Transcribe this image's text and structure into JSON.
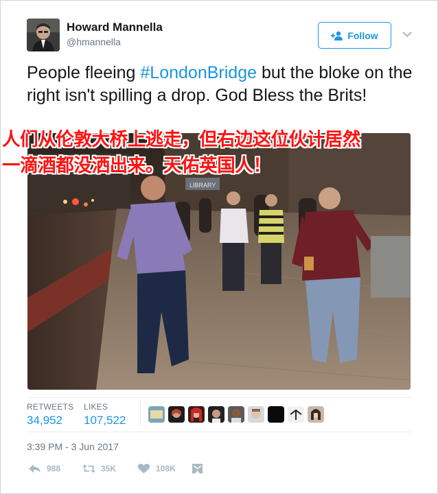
{
  "user": {
    "name": "Howard Mannella",
    "handle": "@hmannella"
  },
  "follow_label": "Follow",
  "tweet": {
    "text_before": "People fleeing ",
    "hashtag": "#LondonBridge",
    "text_after": " but the bloke on the right isn't spilling a drop. God Bless the Brits!"
  },
  "chinese_caption": {
    "line1": "人们从伦敦大桥上逃走，但右边这位伙计居然",
    "line2": "一滴酒都没洒出来。天佑英国人！"
  },
  "photo_sign": "LIBRARY",
  "stats": {
    "retweets_label": "RETWEETS",
    "retweets_value": "34,952",
    "likes_label": "LIKES",
    "likes_value": "107,522"
  },
  "timestamp": "3:39 PM - 3 Jun 2017",
  "actions": {
    "reply_count": "988",
    "retweet_count": "35K",
    "like_count": "108K"
  },
  "colors": {
    "link_blue": "#1b95e0",
    "muted_gray": "#657786",
    "caption_red": "#ff1212"
  }
}
